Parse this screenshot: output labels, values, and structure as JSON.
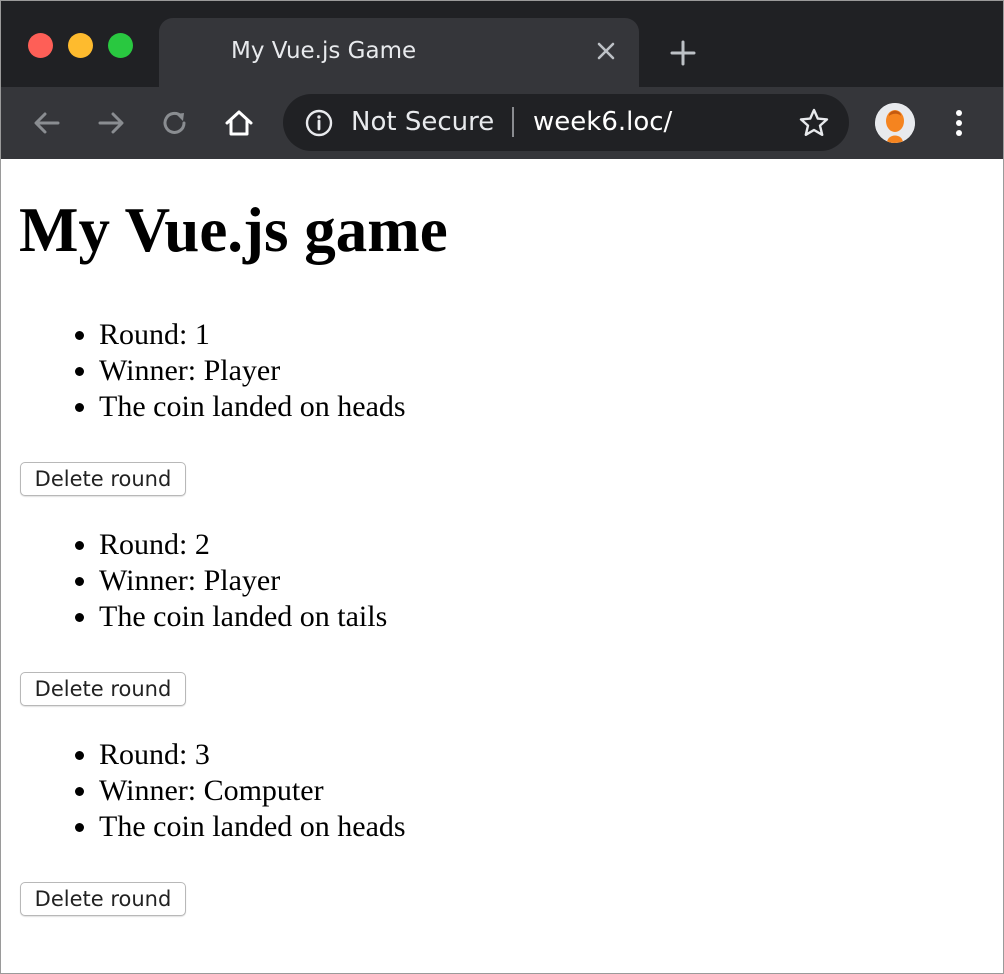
{
  "browser": {
    "tab_title": "My Vue.js Game",
    "security_label": "Not Secure",
    "url": "week6.loc/",
    "icons": {
      "close": "close-icon",
      "new_tab": "plus-icon",
      "back": "arrow-left-icon",
      "forward": "arrow-right-icon",
      "reload": "reload-icon",
      "home": "home-icon",
      "info": "info-icon",
      "bookmark": "star-icon",
      "menu": "kebab-menu-icon"
    },
    "colors": {
      "tabstrip": "#202124",
      "toolbar": "#35363a",
      "traffic_red": "#fe5f57",
      "traffic_yellow": "#febb2e",
      "traffic_green": "#29c840",
      "avatar_accent": "#f5841f"
    }
  },
  "page": {
    "heading": "My Vue.js game",
    "rounds": [
      {
        "round_text": "Round: 1",
        "winner_text": "Winner: Player",
        "coin_text": "The coin landed on heads",
        "delete_label": "Delete round"
      },
      {
        "round_text": "Round: 2",
        "winner_text": "Winner: Player",
        "coin_text": "The coin landed on tails",
        "delete_label": "Delete round"
      },
      {
        "round_text": "Round: 3",
        "winner_text": "Winner: Computer",
        "coin_text": "The coin landed on heads",
        "delete_label": "Delete round"
      }
    ]
  }
}
